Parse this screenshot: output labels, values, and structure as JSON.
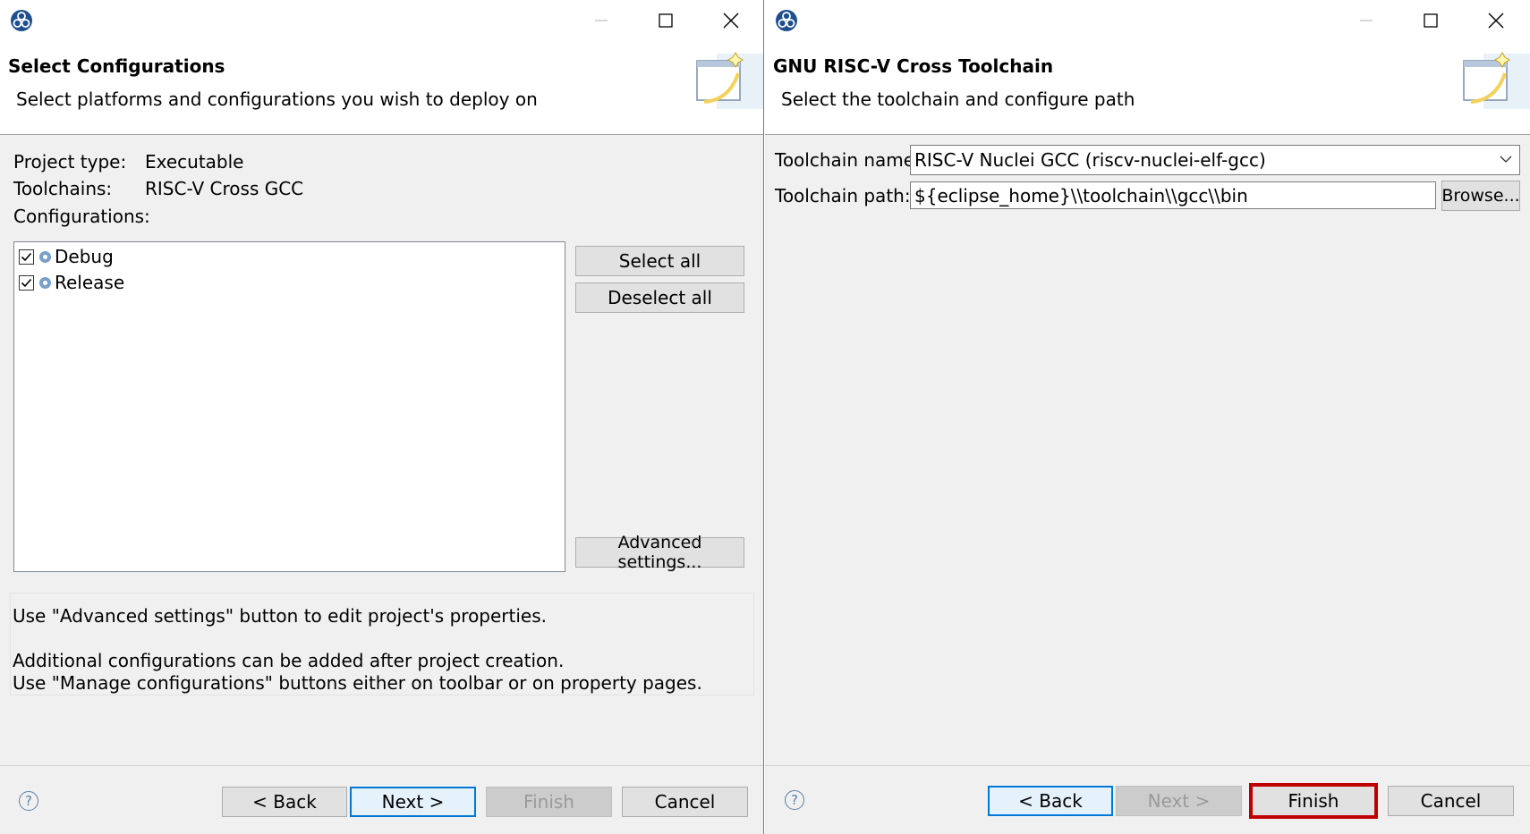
{
  "left_dialog": {
    "header": {
      "title": "Select Configurations",
      "subtitle": "Select platforms and configurations you wish to deploy on"
    },
    "project_type": {
      "label": "Project type:",
      "value": "Executable"
    },
    "toolchains": {
      "label": "Toolchains:",
      "value": "RISC-V Cross GCC"
    },
    "configurations_label": "Configurations:",
    "configurations": [
      {
        "name": "Debug",
        "checked": true
      },
      {
        "name": "Release",
        "checked": true
      }
    ],
    "buttons": {
      "select_all": "Select all",
      "deselect_all": "Deselect all",
      "advanced": "Advanced settings..."
    },
    "info": {
      "line1": "Use \"Advanced settings\" button to edit project's properties.",
      "line2": "Additional configurations can be added after project creation.",
      "line3": "Use \"Manage configurations\" buttons either on toolbar or on property pages."
    },
    "footer": {
      "help": "?",
      "back": "< Back",
      "next": "Next >",
      "finish": "Finish",
      "cancel": "Cancel"
    }
  },
  "right_dialog": {
    "header": {
      "title": "GNU RISC-V Cross Toolchain",
      "subtitle": "Select the toolchain and configure path"
    },
    "toolchain_name": {
      "label": "Toolchain name:",
      "value": "RISC-V Nuclei GCC (riscv-nuclei-elf-gcc)"
    },
    "toolchain_path": {
      "label": "Toolchain path:",
      "value": "${eclipse_home}\\\\toolchain\\\\gcc\\\\bin"
    },
    "browse": "Browse...",
    "footer": {
      "help": "?",
      "back": "< Back",
      "next": "Next >",
      "finish": "Finish",
      "cancel": "Cancel"
    }
  },
  "colors": {
    "focus_border": "#0078d7",
    "highlight_border": "#c00000",
    "dialog_bg": "#f0f0f0"
  }
}
